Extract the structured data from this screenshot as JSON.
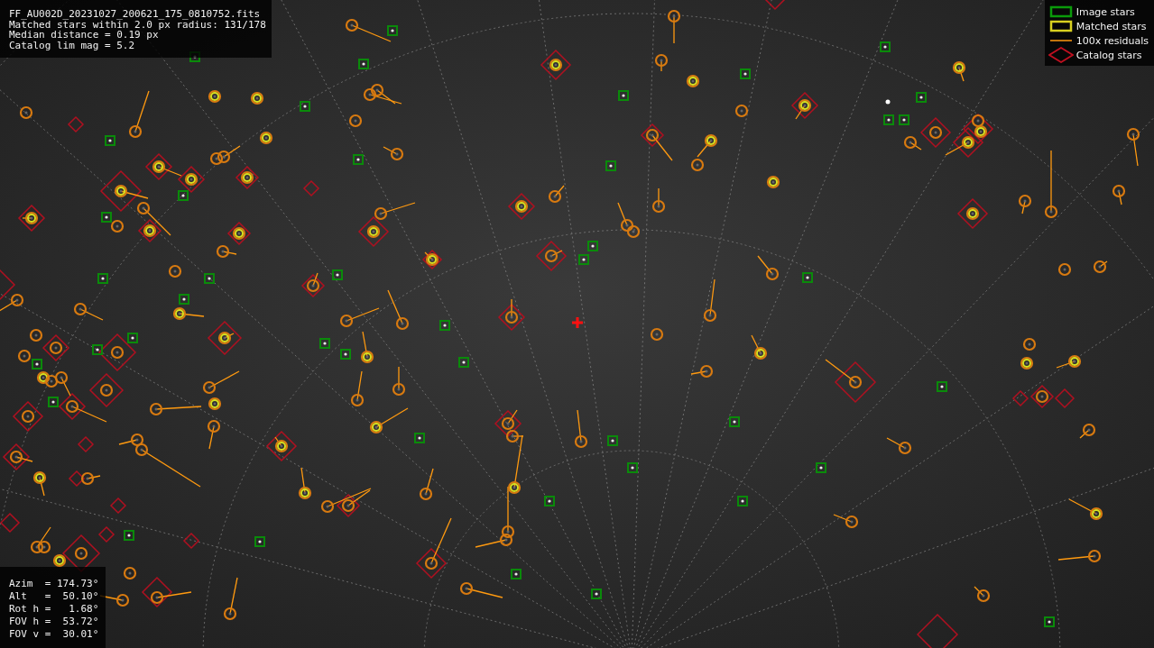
{
  "info_box": {
    "lines": [
      "FF_AU002D_20231027_200621_175_0810752.fits",
      "Matched stars within 2.0 px radius: 131/178",
      "Median distance = 0.19 px",
      "Catalog lim mag = 5.2"
    ]
  },
  "legend": {
    "items": [
      {
        "kind": "image",
        "label": "Image stars"
      },
      {
        "kind": "matched",
        "label": "Matched stars"
      },
      {
        "kind": "residual",
        "label": "100x residuals"
      },
      {
        "kind": "catalog",
        "label": "Catalog stars"
      }
    ]
  },
  "pointing_box": {
    "lines": [
      "Azim  = 174.73°",
      "Alt   =  50.10°",
      "Rot h =   1.68°",
      "FOV h =  53.72°",
      "FOV v =  30.01°"
    ]
  }
}
